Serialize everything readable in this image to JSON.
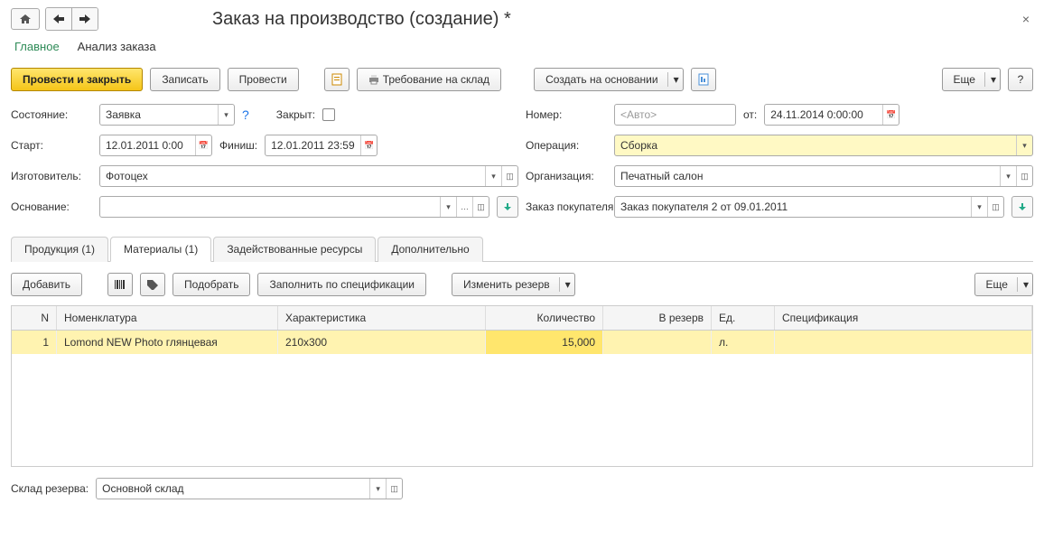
{
  "title": "Заказ на производство (создание) *",
  "mainTabs": {
    "main": "Главное",
    "analysis": "Анализ заказа"
  },
  "commands": {
    "postClose": "Провести и закрыть",
    "save": "Записать",
    "post": "Провести",
    "demand": "Требование на склад",
    "createBased": "Создать на основании",
    "more": "Еще",
    "help": "?"
  },
  "labels": {
    "state": "Состояние:",
    "closed": "Закрыт:",
    "number": "Номер:",
    "numberPlaceholder": "<Авто>",
    "from": "от:",
    "start": "Старт:",
    "finish": "Финиш:",
    "operation": "Операция:",
    "manufacturer": "Изготовитель:",
    "organization": "Организация:",
    "basis": "Основание:",
    "customerOrder": "Заказ покупателя:",
    "reserveWarehouse": "Склад резерва:"
  },
  "values": {
    "state": "Заявка",
    "date": "24.11.2014  0:00:00",
    "start": "12.01.2011  0:00",
    "finish": "12.01.2011 23:59",
    "operation": "Сборка",
    "manufacturer": "Фотоцех",
    "organization": "Печатный салон",
    "basis": "",
    "customerOrder": "Заказ покупателя 2 от 09.01.2011",
    "reserveWarehouse": "Основной склад"
  },
  "subTabs": {
    "products": "Продукция (1)",
    "materials": "Материалы (1)",
    "resources": "Задействованные ресурсы",
    "additional": "Дополнительно"
  },
  "toolbar": {
    "add": "Добавить",
    "pick": "Подобрать",
    "fillSpec": "Заполнить по спецификации",
    "changeReserve": "Изменить резерв",
    "more": "Еще"
  },
  "columns": {
    "n": "N",
    "nomenclature": "Номенклатура",
    "characteristic": "Характеристика",
    "quantity": "Количество",
    "toReserve": "В резерв",
    "unit": "Ед.",
    "spec": "Спецификация"
  },
  "rows": [
    {
      "n": "1",
      "nomenclature": "Lomond NEW Photo глянцевая",
      "characteristic": "210x300",
      "quantity": "15,000",
      "toReserve": "",
      "unit": "л.",
      "spec": ""
    }
  ]
}
